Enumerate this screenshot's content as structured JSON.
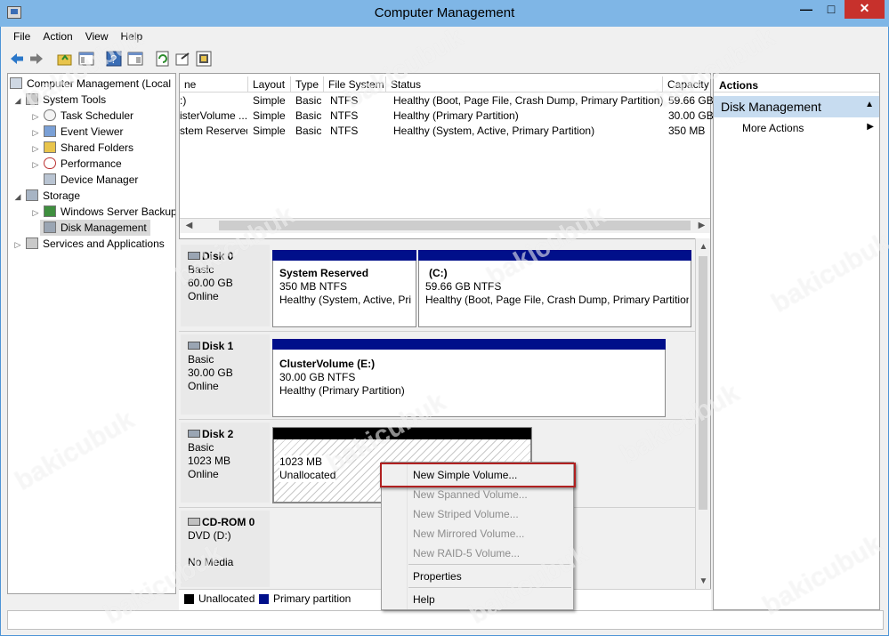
{
  "window": {
    "title": "Computer Management",
    "minimize": "—",
    "maximize": "□",
    "close": "✕"
  },
  "menu": [
    "File",
    "Action",
    "View",
    "Help"
  ],
  "tree": {
    "root": "Computer Management (Local",
    "system_tools": "System Tools",
    "task_scheduler": "Task Scheduler",
    "event_viewer": "Event Viewer",
    "shared_folders": "Shared Folders",
    "performance": "Performance",
    "device_manager": "Device Manager",
    "storage": "Storage",
    "wsb": "Windows Server Backup",
    "disk_management": "Disk Management",
    "services": "Services and Applications"
  },
  "volume_list": {
    "headers": [
      "ne",
      "Layout",
      "Type",
      "File System",
      "Status",
      "Capacity"
    ],
    "rows": [
      [
        ":)",
        "Simple",
        "Basic",
        "NTFS",
        "Healthy (Boot, Page File, Crash Dump, Primary Partition)",
        "59.66 GB"
      ],
      [
        "isterVolume ...",
        "Simple",
        "Basic",
        "NTFS",
        "Healthy (Primary Partition)",
        "30.00 GB"
      ],
      [
        "stem Reserved",
        "Simple",
        "Basic",
        "NTFS",
        "Healthy (System, Active, Primary Partition)",
        "350 MB"
      ]
    ]
  },
  "disks": [
    {
      "name": "Disk 0",
      "type": "Basic",
      "size": "60.00 GB",
      "state": "Online"
    },
    {
      "name": "Disk 1",
      "type": "Basic",
      "size": "30.00 GB",
      "state": "Online"
    },
    {
      "name": "Disk 2",
      "type": "Basic",
      "size": "1023 MB",
      "state": "Online"
    },
    {
      "name": "CD-ROM 0",
      "type": "DVD (D:)",
      "size": "",
      "state": "No Media"
    }
  ],
  "partitions": {
    "sys_reserved": {
      "name": "System Reserved",
      "size": "350 MB NTFS",
      "status": "Healthy (System, Active, Pri"
    },
    "c_drive": {
      "name": "(C:)",
      "size": "59.66 GB NTFS",
      "status": "Healthy (Boot, Page File, Crash Dump, Primary Partition"
    },
    "cluster": {
      "name": "ClusterVolume  (E:)",
      "size": "30.00 GB NTFS",
      "status": "Healthy (Primary Partition)"
    },
    "unalloc": {
      "size": "1023 MB",
      "status": "Unallocated"
    }
  },
  "legend": {
    "unallocated": "Unallocated",
    "primary": "Primary partition"
  },
  "actions": {
    "header": "Actions",
    "section": "Disk Management",
    "more": "More Actions"
  },
  "context_menu": {
    "new_simple": "New Simple Volume...",
    "new_spanned": "New Spanned Volume...",
    "new_striped": "New Striped Volume...",
    "new_mirrored": "New Mirrored Volume...",
    "new_raid5": "New RAID-5 Volume...",
    "properties": "Properties",
    "help": "Help"
  },
  "colors": {
    "partition_header": "#000f8a",
    "highlight_box": "#b02020",
    "title_bar": "#7fb6e6",
    "actions_section": "#c7dcf0"
  },
  "watermark": "bakicubuk"
}
